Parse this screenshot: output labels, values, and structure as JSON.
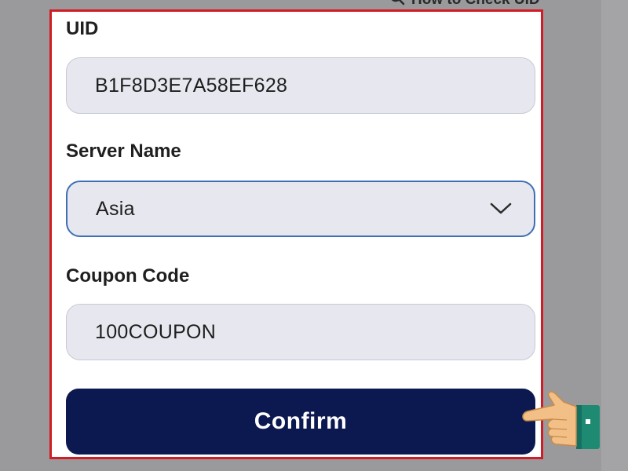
{
  "header": {
    "help_link": "How to Check UID"
  },
  "form": {
    "uid_label": "UID",
    "uid_value": "B1F8D3E7A58EF628",
    "server_label": "Server Name",
    "server_value": "Asia",
    "coupon_label": "Coupon Code",
    "coupon_value": "100COUPON",
    "confirm_label": "Confirm"
  },
  "colors": {
    "highlight_border": "#d21b24",
    "confirm_button": "#0c1850",
    "select_border": "#3e6fb5",
    "input_background": "#e7e8ef"
  },
  "icons": {
    "help_link": "search-icon",
    "server_select": "chevron-down-icon",
    "pointer": "pointing-hand-icon"
  }
}
